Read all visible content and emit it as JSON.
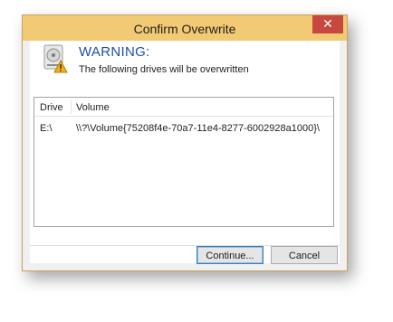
{
  "window": {
    "title": "Confirm Overwrite",
    "close_glyph": "✕"
  },
  "warning": {
    "icon": "drive-warning-icon",
    "heading": "WARNING:",
    "message": "The following drives will be overwritten"
  },
  "table": {
    "columns": [
      "Drive",
      "Volume"
    ],
    "rows": [
      {
        "drive": "E:\\",
        "volume": "\\\\?\\Volume{75208f4e-70a7-11e4-8277-6002928a1000}\\"
      }
    ]
  },
  "buttons": {
    "continue_label": "Continue...",
    "cancel_label": "Cancel"
  },
  "colors": {
    "titlebar": "#f2ca73",
    "close": "#c7483f",
    "heading": "#1f4f9a",
    "default_button_border": "#3c7fb1"
  }
}
